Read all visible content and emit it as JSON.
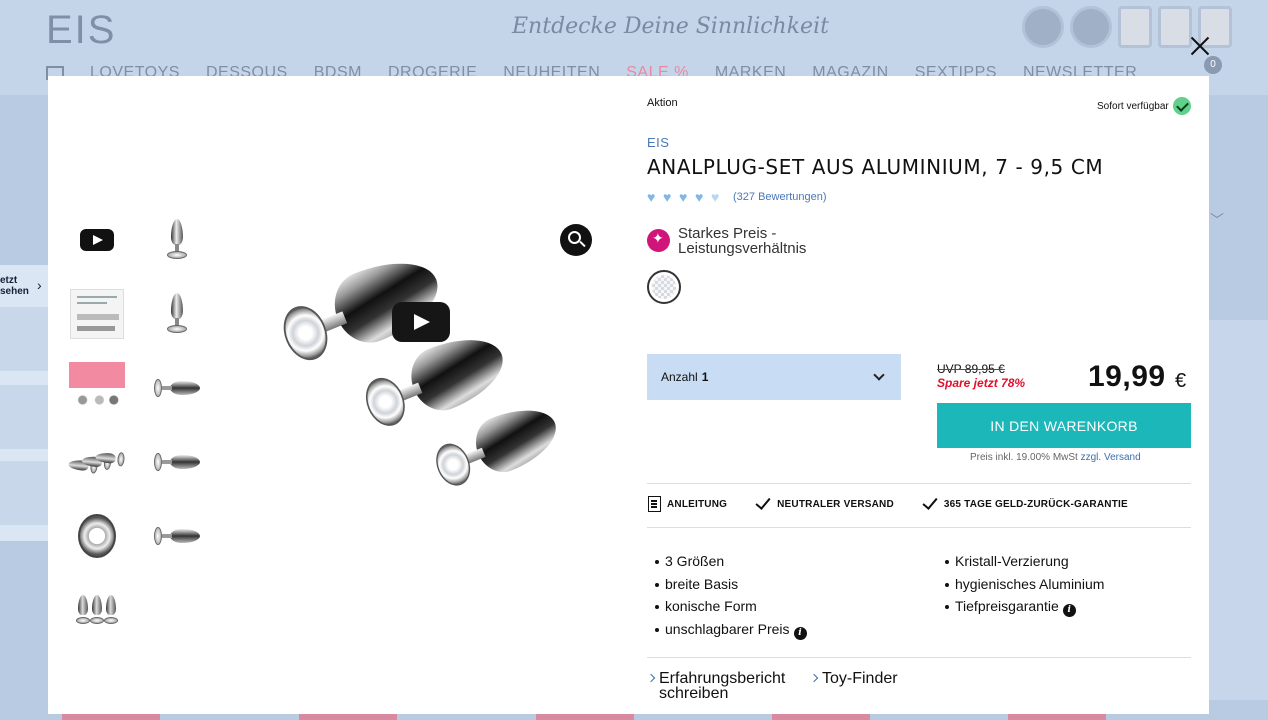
{
  "background": {
    "logo": "EIS",
    "slogan": "Entdecke Deine Sinnlichkeit",
    "nav": [
      "LOVETOYS",
      "DESSOUS",
      "BDSM",
      "DROGERIE",
      "NEUHEITEN",
      "SALE %",
      "MARKEN",
      "MAGAZIN",
      "SEXTIPPS",
      "NEWSLETTER"
    ],
    "cart_count": "0",
    "left_widget_title": "etzt\nsehen"
  },
  "product": {
    "label": "Aktion",
    "stock": "Sofort verfügbar",
    "brand": "EIS",
    "title": "ANALPLUG-SET AUS ALUMINIUM, 7 - 9,5 CM",
    "rating": 4.5,
    "rating_text": "(327 Bewertungen)",
    "usp": "Starkes Preis - Leistungsverhältnis",
    "quantity_label": "Anzahl",
    "quantity_value": "1",
    "uvp": "UVP 89,95 €",
    "save": "Spare jetzt 78%",
    "price": "19,99",
    "currency": "€",
    "cart_button": "IN DEN WARENKORB",
    "vat_text": "Preis inkl. 19.00% MwSt",
    "shipping_link": "zzgl. Versand",
    "features_bar": [
      "ANLEITUNG",
      "NEUTRALER VERSAND",
      "365 TAGE GELD-ZURÜCK-GARANTIE"
    ],
    "bullets_left": [
      "3 Größen",
      "breite Basis",
      "konische Form",
      "unschlagbarer Preis"
    ],
    "bullets_right": [
      "Kristall-Verzierung",
      "hygienisches Aluminium",
      "Tiefpreisgarantie"
    ],
    "links": [
      "Erfahrungsbericht schreiben",
      "Toy-Finder"
    ]
  },
  "colors": {
    "accent": "#1cb7b8",
    "link": "#3a6fb0",
    "sale": "#e0102a",
    "usp": "#d0147a",
    "stock": "#5fd18a"
  }
}
